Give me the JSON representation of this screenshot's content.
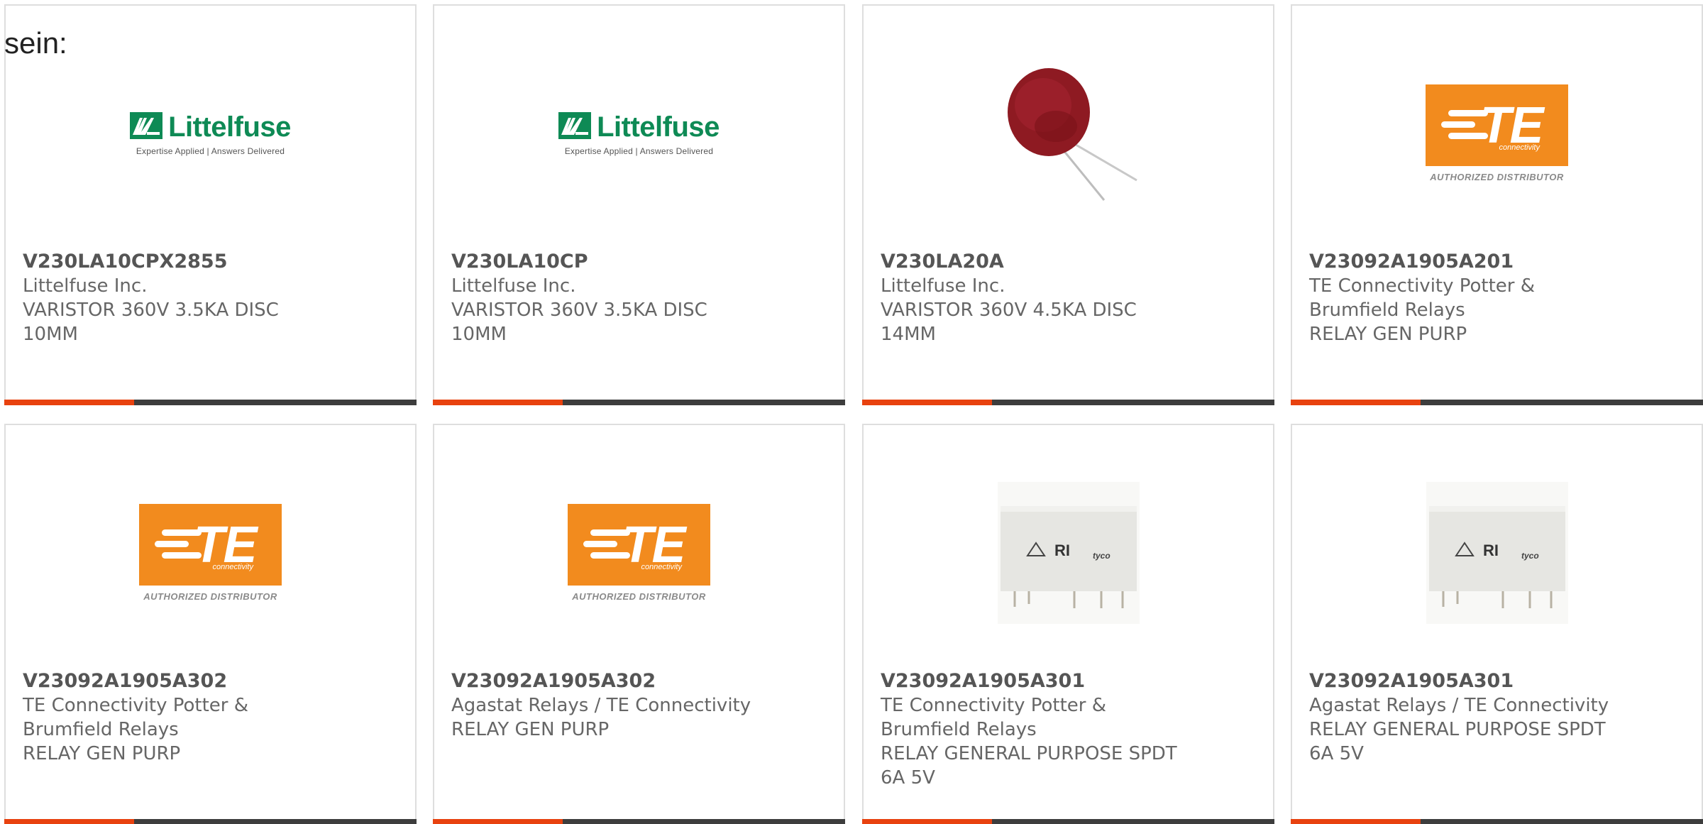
{
  "intro_text": "sein:",
  "colors": {
    "accent": "#e8420f",
    "bar_dark": "#3d3d3d",
    "te_orange": "#f28b1e",
    "littelfuse_green": "#0e8a55"
  },
  "logos": {
    "littelfuse_name": "Littelfuse",
    "littelfuse_tagline": "Expertise Applied | Answers Delivered",
    "te_letters": "TE",
    "te_sub": "connectivity",
    "te_authorized": "AUTHORIZED DISTRIBUTOR",
    "relay_brand": "tyco"
  },
  "products": [
    {
      "part_number": "V230LA10CPX2855",
      "manufacturer": [
        "Littelfuse Inc."
      ],
      "description": [
        "VARISTOR 360V 3.5KA DISC",
        "10MM"
      ],
      "image": "littelfuse-logo"
    },
    {
      "part_number": "V230LA10CP",
      "manufacturer": [
        "Littelfuse Inc."
      ],
      "description": [
        "VARISTOR 360V 3.5KA DISC",
        "10MM"
      ],
      "image": "littelfuse-logo"
    },
    {
      "part_number": "V230LA20A",
      "manufacturer": [
        "Littelfuse Inc."
      ],
      "description": [
        "VARISTOR 360V 4.5KA DISC",
        "14MM"
      ],
      "image": "varistor-photo"
    },
    {
      "part_number": "V23092A1905A201",
      "manufacturer": [
        "TE Connectivity Potter &",
        "Brumfield Relays"
      ],
      "description": [
        "RELAY GEN PURP"
      ],
      "image": "te-logo"
    },
    {
      "part_number": "V23092A1905A302",
      "manufacturer": [
        "TE Connectivity Potter &",
        "Brumfield Relays"
      ],
      "description": [
        "RELAY GEN PURP"
      ],
      "image": "te-logo"
    },
    {
      "part_number": "V23092A1905A302",
      "manufacturer": [
        "Agastat Relays / TE Connectivity"
      ],
      "description": [
        "RELAY GEN PURP"
      ],
      "image": "te-logo"
    },
    {
      "part_number": "V23092A1905A301",
      "manufacturer": [
        "TE Connectivity Potter &",
        "Brumfield Relays"
      ],
      "description": [
        "RELAY GENERAL PURPOSE SPDT",
        "6A 5V"
      ],
      "image": "relay-photo"
    },
    {
      "part_number": "V23092A1905A301",
      "manufacturer": [
        "Agastat Relays / TE Connectivity"
      ],
      "description": [
        "RELAY GENERAL PURPOSE SPDT",
        "6A 5V"
      ],
      "image": "relay-photo"
    }
  ]
}
